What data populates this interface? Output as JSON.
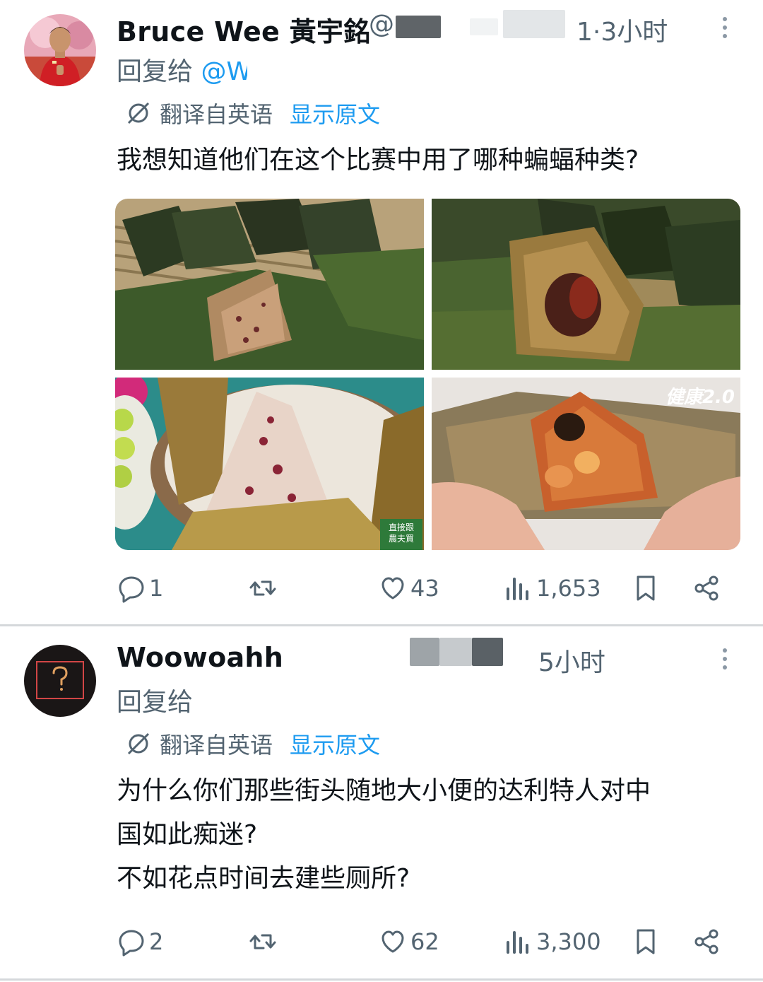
{
  "tweets": [
    {
      "display_name": "Bruce Wee 黃宇銘",
      "handle_visible": "@",
      "time": "1·3小时",
      "reply_prefix": "回复给",
      "reply_mention": "@W",
      "translated_from": "翻译自英语",
      "show_original": "显示原文",
      "text": "我想知道他们在这个比赛中用了哪种蝙蝠种类?",
      "photo_watermark_1": "直接跟\n農夫買",
      "photo_watermark_2": "健康2.0",
      "actions": {
        "replies": "1",
        "reposts": "",
        "likes": "43",
        "views": "1,653"
      }
    },
    {
      "display_name": "Woowoahh",
      "time": "5小时",
      "reply_prefix": "回复给",
      "translated_from": "翻译自英语",
      "show_original": "显示原文",
      "text": "为什么你们那些街头随地大小便的达利特人对中\n国如此痴迷?\n不如花点时间去建些厕所?",
      "actions": {
        "replies": "2",
        "reposts": "",
        "likes": "62",
        "views": "3,300"
      }
    }
  ],
  "icons": {
    "more": "more-vertical-icon",
    "translate": "translate-icon",
    "reply": "reply-icon",
    "repost": "repost-icon",
    "like": "like-icon",
    "views": "views-icon",
    "bookmark": "bookmark-icon",
    "share": "share-icon"
  },
  "colors": {
    "text_primary": "#0f1419",
    "text_secondary": "#536471",
    "accent": "#1d9bf0",
    "separator": "#d5d8db"
  }
}
